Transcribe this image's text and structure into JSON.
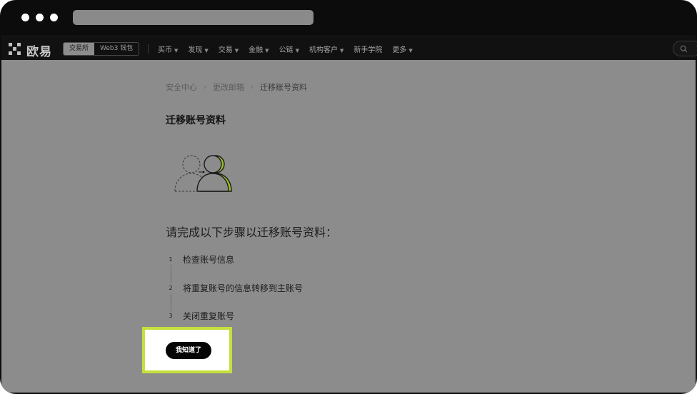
{
  "browser": {
    "traffic_lights": [
      "dot",
      "dot",
      "dot"
    ]
  },
  "nav": {
    "logo_text": "欧易",
    "segments": [
      {
        "label": "交易所",
        "active": true
      },
      {
        "label": "Web3 钱包",
        "active": false
      }
    ],
    "menu": [
      {
        "label": "买币",
        "dropdown": true
      },
      {
        "label": "发现",
        "dropdown": true
      },
      {
        "label": "交易",
        "dropdown": true
      },
      {
        "label": "金融",
        "dropdown": true
      },
      {
        "label": "公链",
        "dropdown": true
      },
      {
        "label": "机构客户",
        "dropdown": true
      },
      {
        "label": "新手学院",
        "dropdown": false
      },
      {
        "label": "更多",
        "dropdown": true
      }
    ],
    "search_icon": "search-icon"
  },
  "breadcrumb": [
    "安全中心",
    "更改邮箱",
    "迁移账号资料"
  ],
  "page": {
    "title": "迁移账号资料",
    "instructions": "请完成以下步骤以迁移账号资料：",
    "steps": [
      {
        "num": "1",
        "text": "检查账号信息"
      },
      {
        "num": "2",
        "text": "将重复账号的信息转移到主账号"
      },
      {
        "num": "3",
        "text": "关闭重复账号"
      }
    ],
    "confirm_label": "我知道了"
  },
  "colors": {
    "accent": "#c6df3c",
    "overlay": "#8c8c8c",
    "nav_bg": "#111111",
    "button_bg": "#050505"
  }
}
